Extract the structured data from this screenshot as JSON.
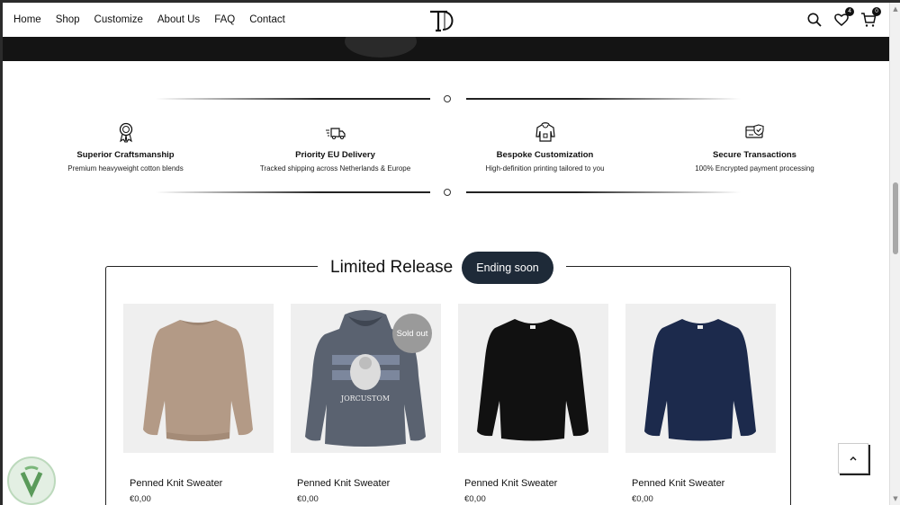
{
  "nav": {
    "items": [
      "Home",
      "Shop",
      "Customize",
      "About Us",
      "FAQ",
      "Contact"
    ]
  },
  "header": {
    "logo_icon": "td-monogram-logo",
    "wishlist_count": "4",
    "cart_count": "0"
  },
  "features": [
    {
      "icon": "award-ribbon-icon",
      "title": "Superior Craftsmanship",
      "subtitle": "Premium heavyweight cotton blends"
    },
    {
      "icon": "fast-delivery-truck-icon",
      "title": "Priority EU Delivery",
      "subtitle": "Tracked shipping across Netherlands & Europe"
    },
    {
      "icon": "hoodie-icon",
      "title": "Bespoke Customization",
      "subtitle": "High-definition printing tailored to you"
    },
    {
      "icon": "secure-card-icon",
      "title": "Secure Transactions",
      "subtitle": "100% Encrypted payment processing"
    }
  ],
  "release": {
    "title": "Limited Release",
    "badge": "Ending soon"
  },
  "products": [
    {
      "name": "Penned Knit Sweater",
      "price": "€0,00",
      "color": "#b39a86",
      "type": "sweater"
    },
    {
      "name": "Penned Knit Sweater",
      "price": "€0,00",
      "color": "#5a6270",
      "type": "hoodie",
      "badge": "Sold out",
      "print_text": "JORCUSTOM"
    },
    {
      "name": "Penned Knit Sweater",
      "price": "€0,00",
      "color": "#111111",
      "type": "sweater"
    },
    {
      "name": "Penned Knit Sweater",
      "price": "€0,00",
      "color": "#1c2a4c",
      "type": "sweater"
    }
  ],
  "colors": {
    "accent_pill": "#1e2a38",
    "soldout_badge": "#9a9a9a"
  }
}
